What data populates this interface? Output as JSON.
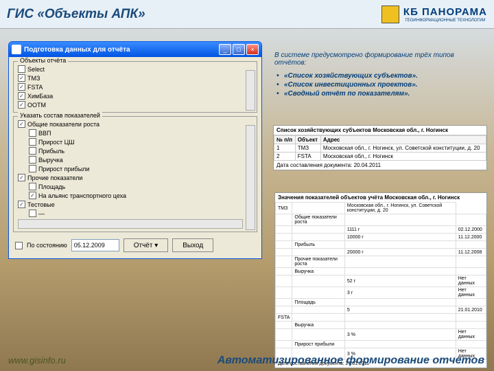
{
  "header": {
    "title": "ГИС «Объекты АПК»",
    "brand": "КБ ПАНОРАМА",
    "brand_sub": "ГЕОИНФОРМАЦИОННЫЕ ТЕХНОЛОГИИ"
  },
  "window": {
    "title": "Подготовка данных для отчёта",
    "group1_label": "Объекты отчёта",
    "objects": [
      {
        "label": "Select",
        "checked": false
      },
      {
        "label": "ТМЗ",
        "checked": true
      },
      {
        "label": "FSTA",
        "checked": true
      },
      {
        "label": "ХимБаза",
        "checked": true
      },
      {
        "label": "ООТМ",
        "checked": true
      }
    ],
    "group2_label": "Указать состав показателей",
    "indicators": [
      {
        "label": "Общие показатели роста",
        "checked": true,
        "lvl": 0
      },
      {
        "label": "ВВП",
        "checked": false,
        "lvl": 1
      },
      {
        "label": "Прирост ЦШ",
        "checked": false,
        "lvl": 1
      },
      {
        "label": "Прибыль",
        "checked": false,
        "lvl": 1
      },
      {
        "label": "Выручка",
        "checked": false,
        "lvl": 1
      },
      {
        "label": "Прирост прибыли",
        "checked": false,
        "lvl": 1
      },
      {
        "label": "Прочие показатели",
        "checked": true,
        "lvl": 0
      },
      {
        "label": "Площадь",
        "checked": false,
        "lvl": 1
      },
      {
        "label": "На альянс транспортного цеха",
        "checked": true,
        "lvl": 1
      },
      {
        "label": "Тестовые",
        "checked": true,
        "lvl": 0
      },
      {
        "label": "—",
        "checked": false,
        "lvl": 1
      }
    ],
    "disclosure_chk": "По состоянию",
    "date_value": "05.12.2009",
    "btn_report": "Отчёт ▾",
    "btn_exit": "Выход"
  },
  "info": {
    "intro": "В системе предусмотрено формирование трёх типов отчётов:",
    "items": [
      "«Список хозяйствующих субъектов».",
      "«Список инвестиционных проектов».",
      "«Сводный отчёт по показателям»."
    ]
  },
  "report1": {
    "title": "Список хозяйствующих субъектов Московская обл., г. Ногинск",
    "cols": [
      "№ п/п",
      "Объект",
      "Адрес"
    ],
    "rows": [
      [
        "1",
        "ТМЗ",
        "Московская обл., г. Ногинск, ул. Советской конституции, д. 20"
      ],
      [
        "2",
        "FSTA",
        "Московская обл., г. Ногинск"
      ]
    ],
    "footer": "Дата составления документа: 20.04.2011"
  },
  "report2": {
    "title": "Значения показателей объектов учёта Московская обл., г. Ногинск",
    "rows": [
      [
        "ТМЗ",
        "",
        "Московская обл., г. Ногинск, ул. Советской конституции, д. 20"
      ],
      [
        "",
        "Общие показатели роста",
        "",
        ""
      ],
      [
        "",
        "",
        "1111 г",
        "02.12.2000"
      ],
      [
        "",
        "",
        "10000 г",
        "11.12.2000"
      ],
      [
        "",
        "Прибыль",
        "",
        ""
      ],
      [
        "",
        "",
        "20000 г",
        "11.12.2008"
      ],
      [
        "",
        "Прочие показатели роста",
        "",
        ""
      ],
      [
        "",
        "Выручка",
        "",
        ""
      ],
      [
        "",
        "",
        "52 г",
        "Нет данных"
      ],
      [
        "",
        "",
        "3 г",
        "Нет данных"
      ],
      [
        "",
        "Площадь",
        "",
        ""
      ],
      [
        "",
        "",
        "5",
        "21.01.2010"
      ],
      [
        "FSTA",
        "",
        "",
        ""
      ],
      [
        "",
        "Выручка",
        "",
        ""
      ],
      [
        "",
        "",
        "3 %",
        "Нет данных"
      ],
      [
        "",
        "Прирост прибыли",
        "",
        ""
      ],
      [
        "",
        "",
        "3 %",
        "Нет данных"
      ]
    ],
    "footer": "Дата составления документа: 27.01.2011"
  },
  "page_footer": "Автоматизированное формирование отчетов",
  "url": "www.gisinfo.ru"
}
